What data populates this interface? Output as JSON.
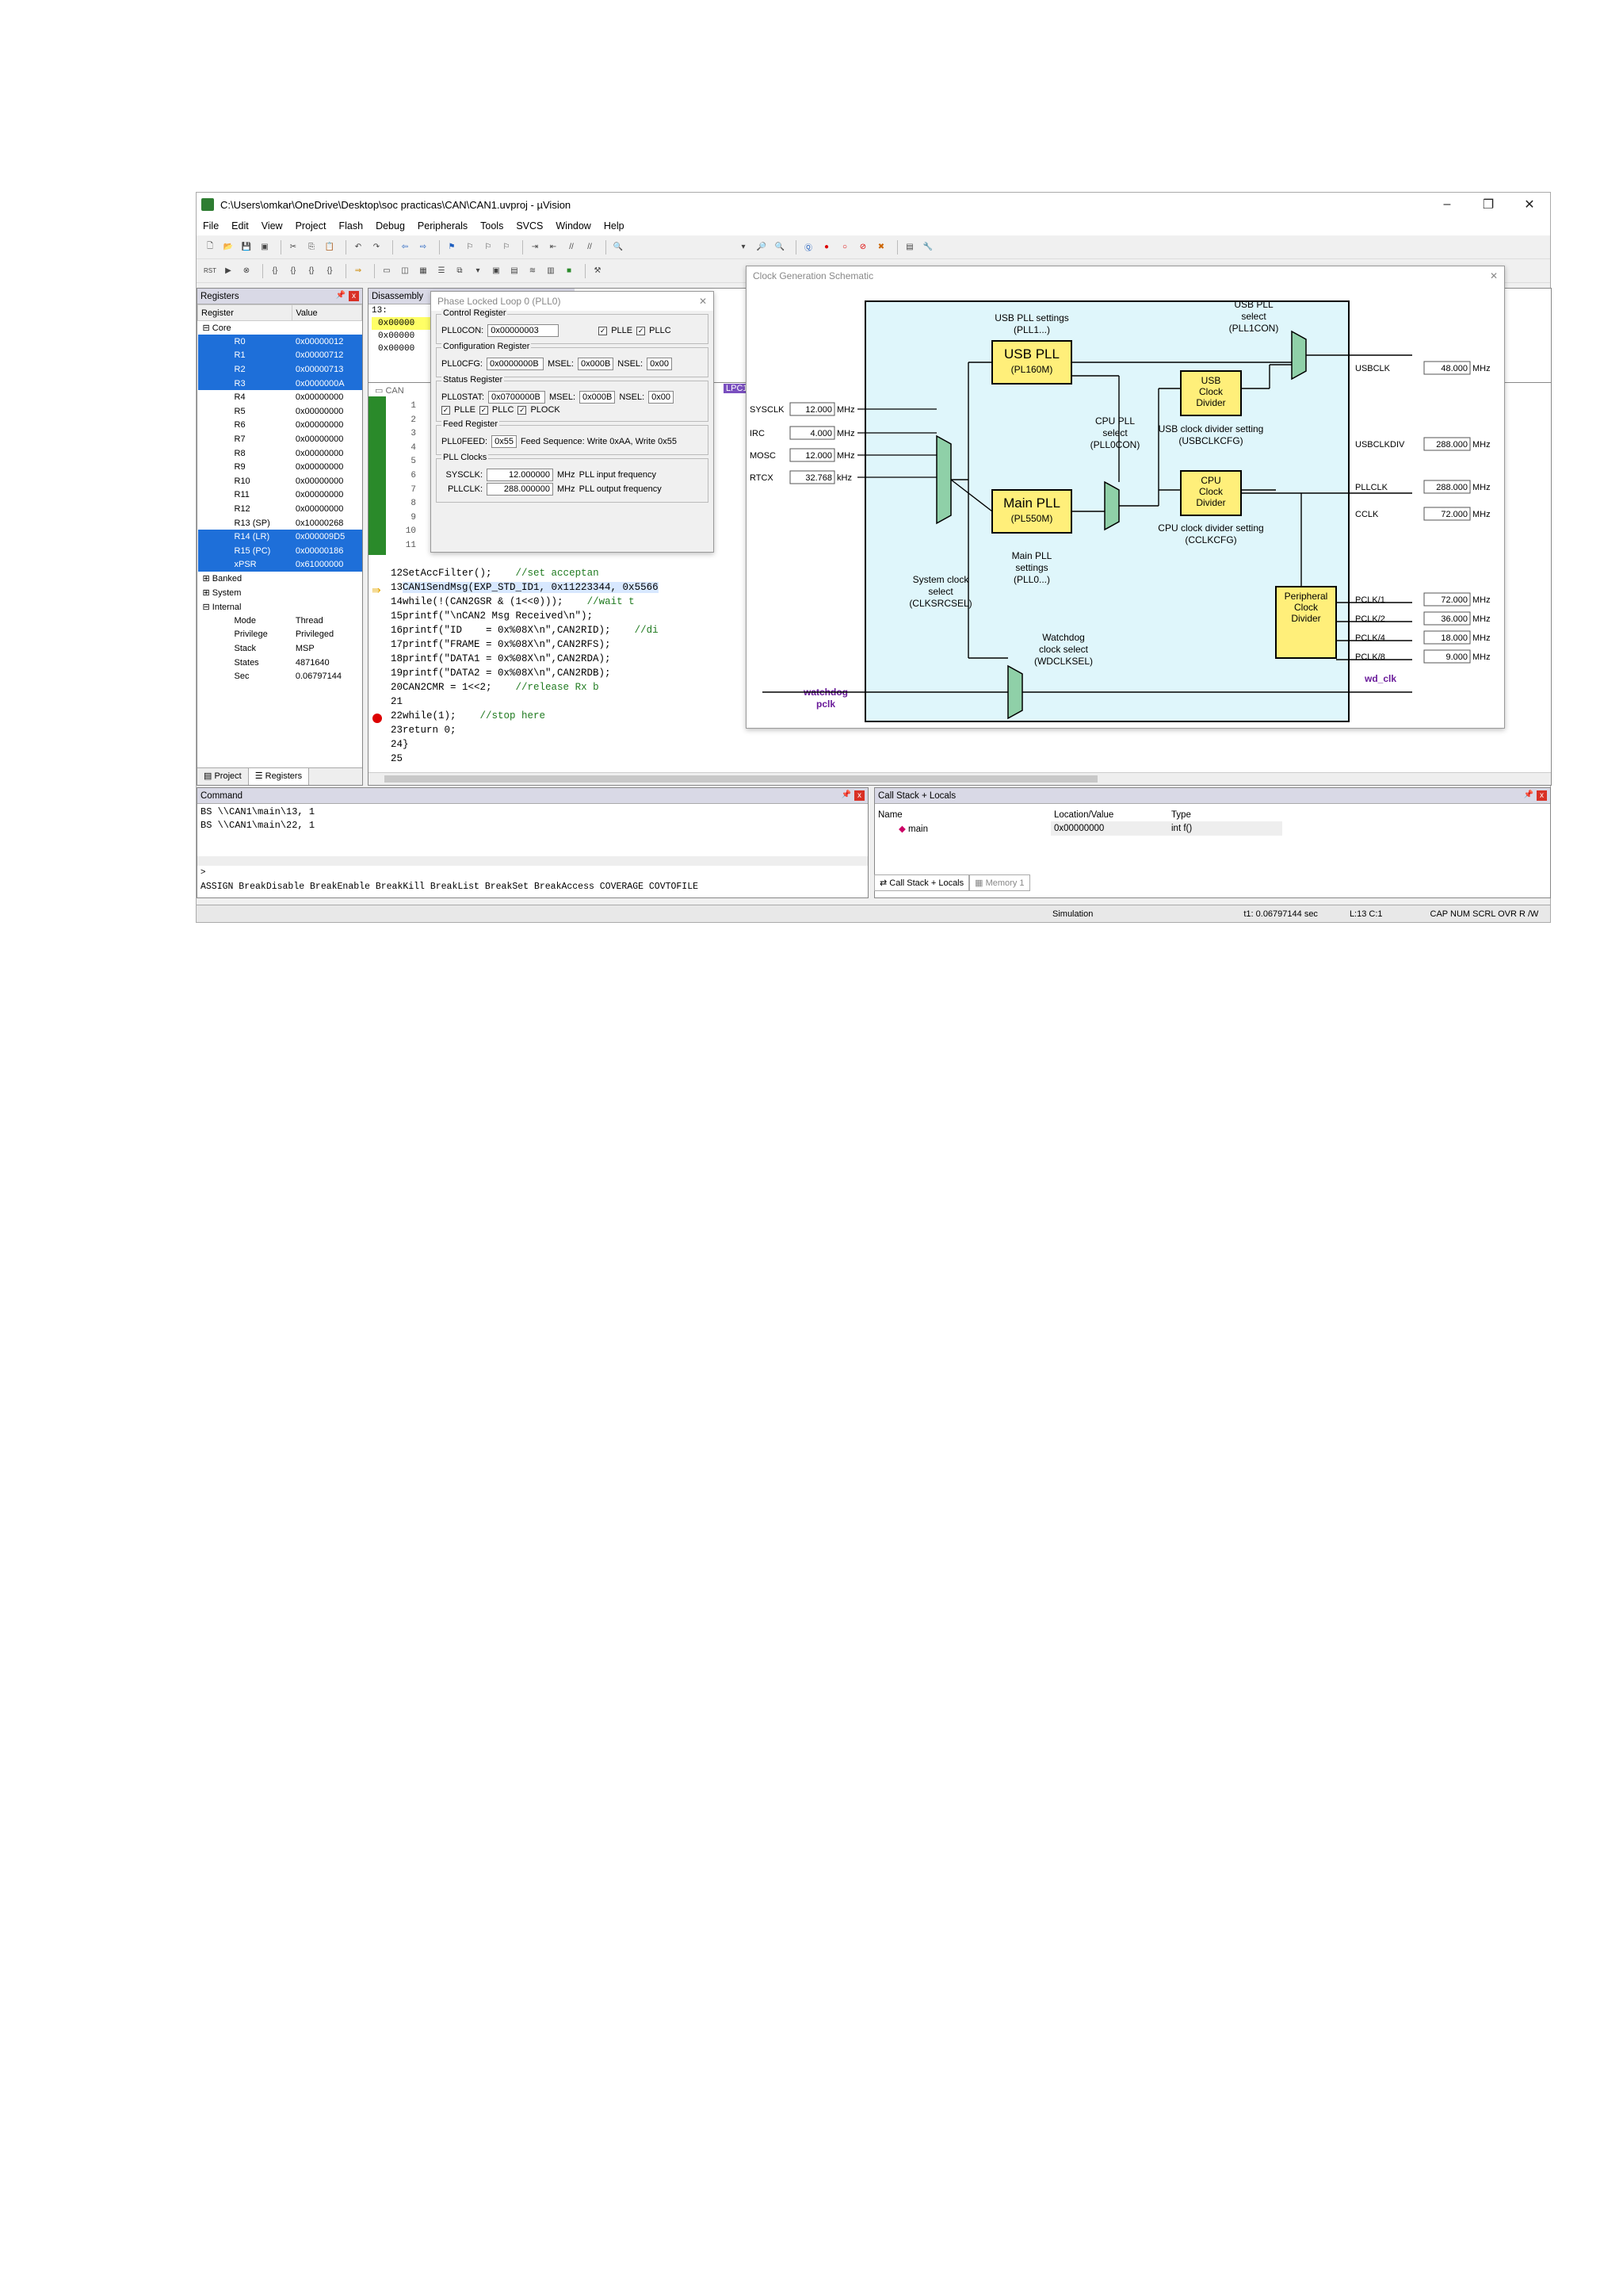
{
  "window": {
    "title": "C:\\Users\\omkar\\OneDrive\\Desktop\\soc practicas\\CAN\\CAN1.uvproj - µVision"
  },
  "menu": [
    "File",
    "Edit",
    "View",
    "Project",
    "Flash",
    "Debug",
    "Peripherals",
    "Tools",
    "SVCS",
    "Window",
    "Help"
  ],
  "registers": {
    "pane_title": "Registers",
    "col_register": "Register",
    "col_value": "Value",
    "core_label": "Core",
    "rows": [
      {
        "name": "R0",
        "value": "0x00000012",
        "sel": true
      },
      {
        "name": "R1",
        "value": "0x00000712",
        "sel": true
      },
      {
        "name": "R2",
        "value": "0x00000713",
        "sel": true
      },
      {
        "name": "R3",
        "value": "0x0000000A",
        "sel": true
      },
      {
        "name": "R4",
        "value": "0x00000000",
        "sel": false
      },
      {
        "name": "R5",
        "value": "0x00000000",
        "sel": false
      },
      {
        "name": "R6",
        "value": "0x00000000",
        "sel": false
      },
      {
        "name": "R7",
        "value": "0x00000000",
        "sel": false
      },
      {
        "name": "R8",
        "value": "0x00000000",
        "sel": false
      },
      {
        "name": "R9",
        "value": "0x00000000",
        "sel": false
      },
      {
        "name": "R10",
        "value": "0x00000000",
        "sel": false
      },
      {
        "name": "R11",
        "value": "0x00000000",
        "sel": false
      },
      {
        "name": "R12",
        "value": "0x00000000",
        "sel": false
      },
      {
        "name": "R13 (SP)",
        "value": "0x10000268",
        "sel": false
      },
      {
        "name": "R14 (LR)",
        "value": "0x000009D5",
        "sel": true
      },
      {
        "name": "R15 (PC)",
        "value": "0x00000186",
        "sel": true
      },
      {
        "name": "xPSR",
        "value": "0x61000000",
        "sel": true
      }
    ],
    "banked": "Banked",
    "system": "System",
    "internal": "Internal",
    "internal_rows": [
      {
        "name": "Mode",
        "value": "Thread"
      },
      {
        "name": "Privilege",
        "value": "Privileged"
      },
      {
        "name": "Stack",
        "value": "MSP"
      },
      {
        "name": "States",
        "value": "4871640"
      },
      {
        "name": "Sec",
        "value": "0.06797144"
      }
    ],
    "tab_project": "Project",
    "tab_registers": "Registers"
  },
  "disassembly": {
    "title": "Disassembly",
    "lines": [
      "13:",
      "0x00000",
      "0x00000",
      "0x00000"
    ],
    "tab_label": "LPC17"
  },
  "code": {
    "lines": [
      {
        "n": "12",
        "t": "SetAccFilter();",
        "c": "//set acceptan"
      },
      {
        "n": "13",
        "t": "CAN1SendMsg(EXP_STD_ID1, 0x11223344, 0x5566",
        "c": ""
      },
      {
        "n": "14",
        "t": "while(!(CAN2GSR & (1<<0)));",
        "c": "//wait t"
      },
      {
        "n": "15",
        "t": "printf(\"\\nCAN2 Msg Received\\n\");",
        "c": ""
      },
      {
        "n": "16",
        "t": "printf(\"ID    = 0x%08X\\n\",CAN2RID);",
        "c": "//di"
      },
      {
        "n": "17",
        "t": "printf(\"FRAME = 0x%08X\\n\",CAN2RFS);",
        "c": ""
      },
      {
        "n": "18",
        "t": "printf(\"DATA1 = 0x%08X\\n\",CAN2RDA);",
        "c": ""
      },
      {
        "n": "19",
        "t": "printf(\"DATA2 = 0x%08X\\n\",CAN2RDB);",
        "c": ""
      },
      {
        "n": "20",
        "t": "CAN2CMR = 1<<2;",
        "c": "//release Rx b"
      },
      {
        "n": "21",
        "t": "",
        "c": ""
      },
      {
        "n": "22",
        "t": "while(1);",
        "c": "//stop here"
      },
      {
        "n": "23",
        "t": "return 0;",
        "c": ""
      },
      {
        "n": "24",
        "t": "}",
        "c": ""
      },
      {
        "n": "25",
        "t": "",
        "c": ""
      }
    ],
    "gutter_numbers": [
      "1",
      "2",
      "3",
      "4",
      "5",
      "6",
      "7",
      "8",
      "9",
      "10",
      "11"
    ]
  },
  "pll": {
    "title": "Phase Locked Loop 0 (PLL0)",
    "control_group": "Control Register",
    "pll0con_label": "PLL0CON:",
    "pll0con_value": "0x00000003",
    "plle": "PLLE",
    "pllc": "PLLC",
    "config_group": "Configuration Register",
    "pll0cfg_label": "PLL0CFG:",
    "pll0cfg_value": "0x0000000B",
    "msel_label": "MSEL:",
    "msel_value": "0x000B",
    "nsel_label": "NSEL:",
    "nsel_value": "0x00",
    "status_group": "Status Register",
    "pll0stat_label": "PLL0STAT:",
    "pll0stat_value": "0x0700000B",
    "msel2_value": "0x000B",
    "nsel2_value": "0x00",
    "plock": "PLOCK",
    "feed_group": "Feed Register",
    "pll0feed_label": "PLL0FEED:",
    "pll0feed_value": "0x55",
    "feed_seq": "Feed Sequence: Write 0xAA, Write 0x55",
    "clocks_group": "PLL Clocks",
    "sysclk_label": "SYSCLK:",
    "sysclk_value": "12.000000",
    "sysclk_desc": "PLL input frequency",
    "pllclk_label": "PLLCLK:",
    "pllclk_value": "288.000000",
    "pllclk_desc": "PLL output frequency",
    "mhz": "MHz"
  },
  "schematic": {
    "title": "Clock Generation Schematic",
    "usb_pll_settings": "USB PLL settings",
    "usb_pll_settings2": "(PLL1...)",
    "usb_pll": "USB PLL",
    "usb_pll_sub": "(PL160M)",
    "usb_pll_select": "USB PLL",
    "usb_pll_select2": "select",
    "usb_pll_select3": "(PLL1CON)",
    "cpu_pll_select": "CPU PLL",
    "cpu_pll_select2": "select",
    "cpu_pll_select3": "(PLL0CON)",
    "usb_clock_divider": [
      "USB",
      "Clock",
      "Divider"
    ],
    "usb_div_setting": "USB clock divider setting",
    "usb_div_setting2": "(USBCLKCFG)",
    "main_pll": "Main PLL",
    "main_pll_sub": "(PL550M)",
    "cpu_clock_divider": [
      "CPU",
      "Clock",
      "Divider"
    ],
    "cpu_div_setting": "CPU clock divider setting",
    "cpu_div_setting2": "(CCLKCFG)",
    "sys_clock_select": [
      "System clock",
      "select",
      "(CLKSRCSEL)"
    ],
    "main_pll_settings": [
      "Main PLL",
      "settings",
      "(PLL0...)"
    ],
    "wd_select": [
      "Watchdog",
      "clock select",
      "(WDCLKSEL)"
    ],
    "periph_div": [
      "Peripheral",
      "Clock",
      "Divider"
    ],
    "watchdog_pclk": [
      "watchdog",
      "pclk"
    ],
    "wd_clk": "wd_clk",
    "inputs": [
      {
        "label": "SYSCLK",
        "value": "12.000",
        "unit": "MHz"
      },
      {
        "label": "IRC",
        "value": "4.000",
        "unit": "MHz"
      },
      {
        "label": "MOSC",
        "value": "12.000",
        "unit": "MHz"
      },
      {
        "label": "RTCX",
        "value": "32.768",
        "unit": "kHz"
      }
    ],
    "outputs": [
      {
        "label": "USBCLK",
        "value": "48.000",
        "unit": "MHz"
      },
      {
        "label": "USBCLKDIV",
        "value": "288.000",
        "unit": "MHz"
      },
      {
        "label": "PLLCLK",
        "value": "288.000",
        "unit": "MHz"
      },
      {
        "label": "CCLK",
        "value": "72.000",
        "unit": "MHz"
      },
      {
        "label": "PCLK/1",
        "value": "72.000",
        "unit": "MHz"
      },
      {
        "label": "PCLK/2",
        "value": "36.000",
        "unit": "MHz"
      },
      {
        "label": "PCLK/4",
        "value": "18.000",
        "unit": "MHz"
      },
      {
        "label": "PCLK/8",
        "value": "9.000",
        "unit": "MHz"
      }
    ]
  },
  "command": {
    "title": "Command",
    "lines": [
      "BS \\\\CAN1\\main\\13, 1",
      "BS \\\\CAN1\\main\\22, 1"
    ],
    "prompt": ">",
    "hint": "ASSIGN BreakDisable BreakEnable BreakKill BreakList BreakSet BreakAccess COVERAGE COVTOFILE"
  },
  "callstack": {
    "title": "Call Stack + Locals",
    "col_name": "Name",
    "col_loc": "Location/Value",
    "col_type": "Type",
    "row_name": "main",
    "row_loc": "0x00000000",
    "row_type": "int f()",
    "tab_cs": "Call Stack + Locals",
    "tab_mem": "Memory 1"
  },
  "status": {
    "mode": "Simulation",
    "time": "t1: 0.06797144 sec",
    "pos": "L:13 C:1",
    "flags": "CAP  NUM  SCRL  OVR  R /W"
  }
}
